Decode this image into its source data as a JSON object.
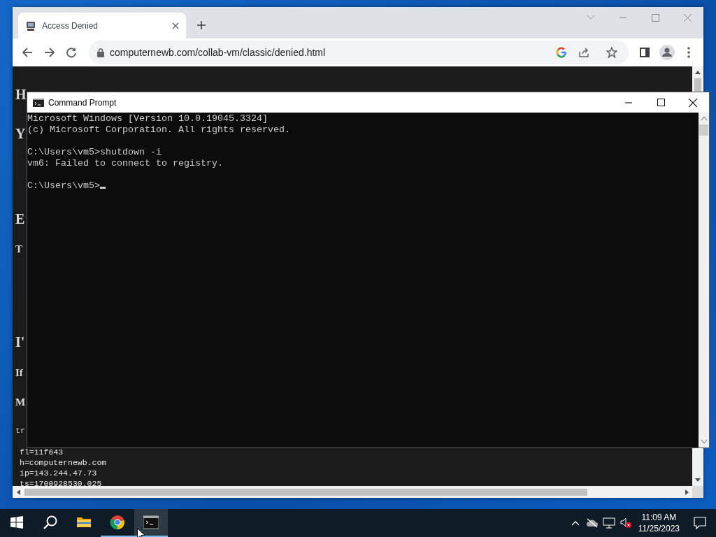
{
  "browser": {
    "tab": {
      "title": "Access Denied",
      "selected": true
    },
    "address": "computernewb.com/collab-vm/classic/denied.html",
    "page": {
      "lines": [
        {
          "kind": "title",
          "text": "H"
        },
        {
          "kind": "heading",
          "text": "Y"
        },
        {
          "kind": "heading",
          "text": "E"
        },
        {
          "kind": "strong",
          "text": "T"
        },
        {
          "kind": "heading",
          "text": "I'"
        },
        {
          "kind": "strong",
          "text": "If"
        },
        {
          "kind": "strong",
          "text": "M"
        },
        {
          "kind": "mono",
          "text": "tr"
        }
      ],
      "info_lines": [
        "fl=11f643",
        "h=computernewb.com",
        "ip=143.244.47.73",
        "ts=1700928530.025"
      ]
    }
  },
  "cmd": {
    "title": "Command Prompt",
    "blocks": [
      [
        "Microsoft Windows [Version 10.0.19045.3324]",
        "(c) Microsoft Corporation. All rights reserved."
      ],
      [
        "C:\\Users\\vm5>shutdown -i",
        "vm6: Failed to connect to registry."
      ],
      [
        "C:\\Users\\vm5>"
      ]
    ]
  },
  "taskbar": {
    "apps": [
      {
        "kind": "explorer",
        "running": false,
        "active": false
      },
      {
        "kind": "browser",
        "running": true,
        "active": false
      },
      {
        "kind": "terminal",
        "running": true,
        "active": true
      }
    ],
    "clock": {
      "time": "11:09 AM",
      "date": "11/25/2023"
    }
  }
}
